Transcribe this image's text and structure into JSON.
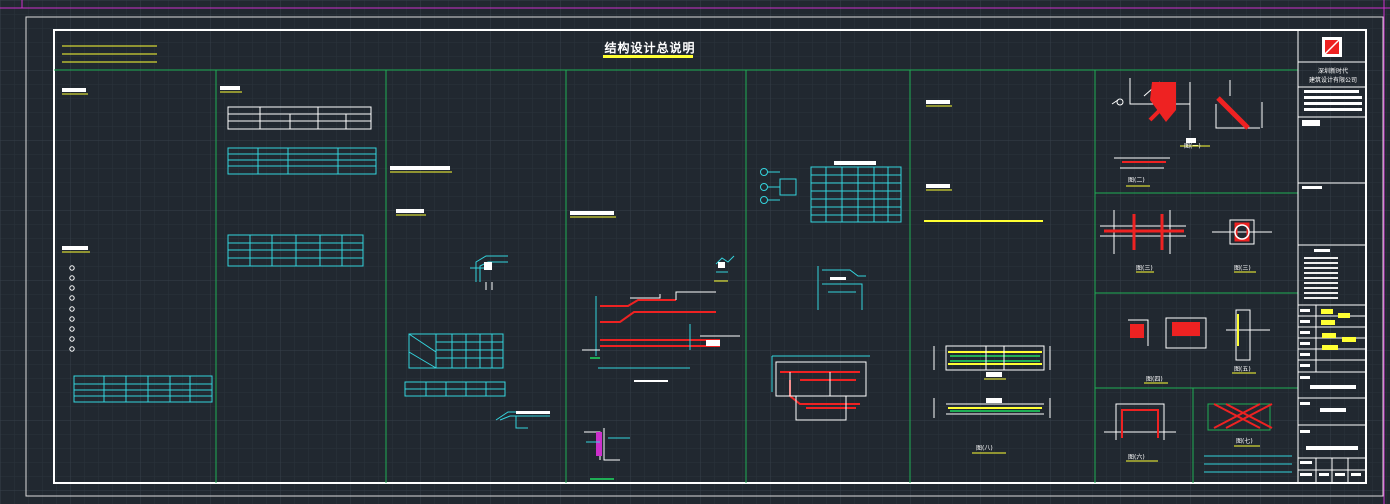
{
  "drawing": {
    "title": "结构设计总说明",
    "company_line1": "深圳新时代",
    "company_line2": "建筑设计有限公司",
    "figure_captions": [
      "图(一)",
      "图(二)",
      "图(三)",
      "图(三)",
      "图(四)",
      "图(五)",
      "图(六)",
      "图(七)",
      "图(八)"
    ]
  },
  "colors": {
    "background": "#212830",
    "sheet_border": "#ffffff",
    "panel_lines": "#1fae55",
    "table_lines": "#34d4dd",
    "highlight": "#ffff33",
    "rebar": "#ff2222",
    "viewport_border": "#cc2fcc"
  }
}
